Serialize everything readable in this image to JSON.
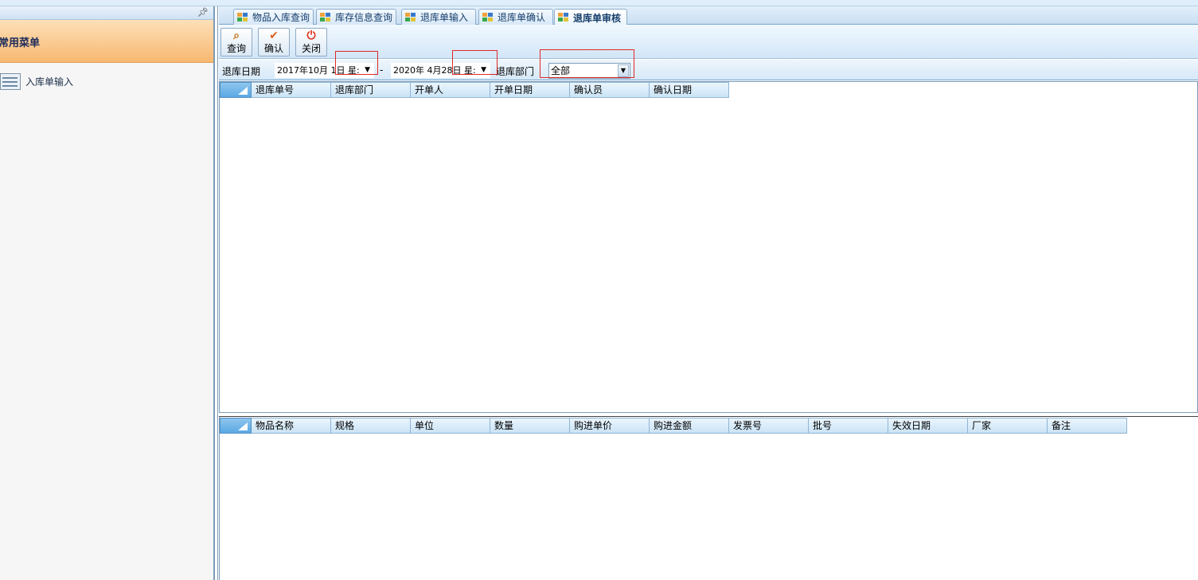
{
  "left_panel": {
    "pin_icon": "pin-icon",
    "header_title": "常用菜单",
    "items": [
      {
        "label": "入库单输入",
        "icon": "list-icon"
      }
    ]
  },
  "tabs": [
    {
      "label": "物品入库查询",
      "active": false
    },
    {
      "label": "库存信息查询",
      "active": false
    },
    {
      "label": "退库单输入",
      "active": false
    },
    {
      "label": "退库单确认",
      "active": false
    },
    {
      "label": "退库单审核",
      "active": true
    }
  ],
  "toolbar": {
    "query_label": "查询",
    "confirm_label": "确认",
    "close_label": "关闭"
  },
  "filter": {
    "date_label": "退库日期",
    "start_date": "2017年10月 1日 星:",
    "separator": "-",
    "end_date": "2020年 4月28日 星:",
    "dept_label": "退库部门",
    "dept_value": "全部"
  },
  "master_grid": {
    "columns": [
      "退库单号",
      "退库部门",
      "开单人",
      "开单日期",
      "确认员",
      "确认日期"
    ]
  },
  "detail_grid": {
    "columns": [
      "物品名称",
      "规格",
      "单位",
      "数量",
      "购进单价",
      "购进金额",
      "发票号",
      "批号",
      "失效日期",
      "厂家",
      "备注"
    ]
  },
  "colors": {
    "accent": "#5aa8e4",
    "menu_header": "#f7b871",
    "highlight_box": "#e02828"
  }
}
